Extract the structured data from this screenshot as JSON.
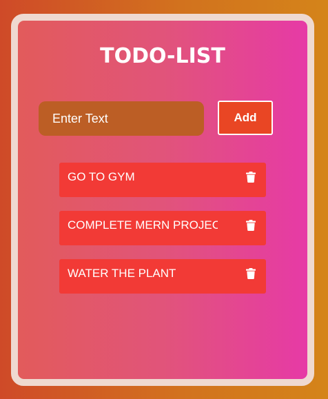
{
  "app": {
    "title": "TODO-LIST"
  },
  "input": {
    "placeholder": "Enter Text",
    "value": ""
  },
  "add_button": {
    "label": "Add"
  },
  "todos": [
    {
      "text": "GO TO GYM",
      "icon": "trash-icon"
    },
    {
      "text": "COMPLETE MERN PROJECT",
      "icon": "trash-icon"
    },
    {
      "text": "WATER THE PLANT",
      "icon": "trash-icon"
    }
  ],
  "colors": {
    "card_start": "#e25b5b",
    "card_end": "#e63aa6",
    "input_bg": "#bc5e25",
    "button_bg": "#e94624",
    "item_bg": "#f23a36",
    "text": "#ffffff"
  }
}
